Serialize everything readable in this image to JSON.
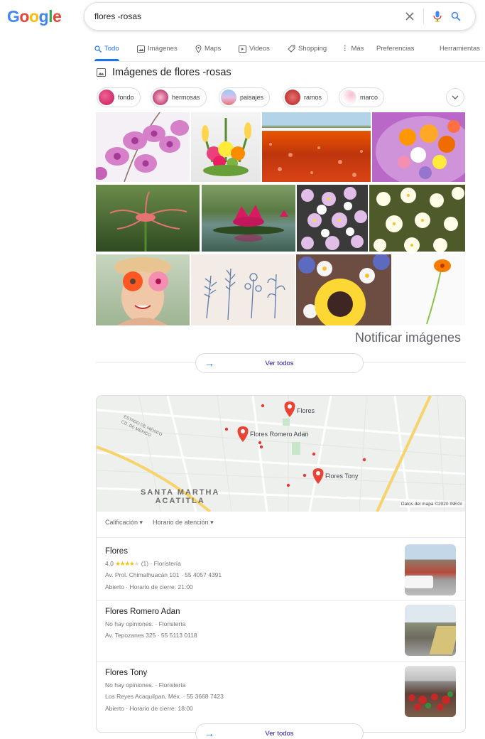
{
  "logo": {
    "letters": [
      "G",
      "o",
      "o",
      "g",
      "l",
      "e"
    ],
    "colors": [
      "#4285f4",
      "#ea4335",
      "#fbbc05",
      "#4285f4",
      "#34a853",
      "#ea4335"
    ]
  },
  "search": {
    "query": "flores -rosas",
    "clear_icon": "close-icon",
    "mic_icon": "mic-icon",
    "search_icon": "search-icon"
  },
  "tabs": [
    {
      "label": "Todo",
      "icon": "search-icon",
      "active": true
    },
    {
      "label": "Imágenes",
      "icon": "image-icon"
    },
    {
      "label": "Maps",
      "icon": "map-pin-icon"
    },
    {
      "label": "Videos",
      "icon": "video-icon"
    },
    {
      "label": "Shopping",
      "icon": "tag-icon"
    },
    {
      "label": "Más",
      "icon": "more-vert-icon"
    },
    {
      "label": "Preferencias"
    },
    {
      "label": "Herramientas"
    }
  ],
  "images": {
    "title": "Imágenes de flores -rosas",
    "chips": [
      "fondo",
      "hermosas",
      "paisajes",
      "ramos",
      "marco"
    ],
    "report_label": "Notificar imágenes",
    "see_all": "Ver todos"
  },
  "map": {
    "pins": [
      "Flores",
      "Flores Romero Adan",
      "Flores Tony"
    ],
    "area_label": "SANTA MARTHA\nACATITLA",
    "state_label": "ESTADO DE MÉXICO\nCD. DE MÉXICO",
    "attribution": "Datos del mapa ©2020 INEGI"
  },
  "filters": [
    "Calificación ▾",
    "Horario de atención ▾"
  ],
  "businesses": [
    {
      "name": "Flores",
      "rating": "4,0",
      "stars": "★★★★",
      "empty_star": "★",
      "rating_rest": "(1) · Florístería",
      "address": "Av. Prol. Chimalhuacán 101 · 55 4057 4391",
      "hours": "Abierto · Horario de cierre: 21:00"
    },
    {
      "name": "Flores Romero Adan",
      "reviews": "No hay opiniones. · Floristería",
      "address": "Av. Tepozanes 325 · 55 5113 0118"
    },
    {
      "name": "Flores Tony",
      "reviews": "No hay opiniones. · Floristería",
      "address": "Los Reyes Acaquilpan, Méx. · 55 3668 7423",
      "hours": "Abierto · Horario de cierre: 18:00"
    }
  ],
  "local_see_all": "Ver todos"
}
